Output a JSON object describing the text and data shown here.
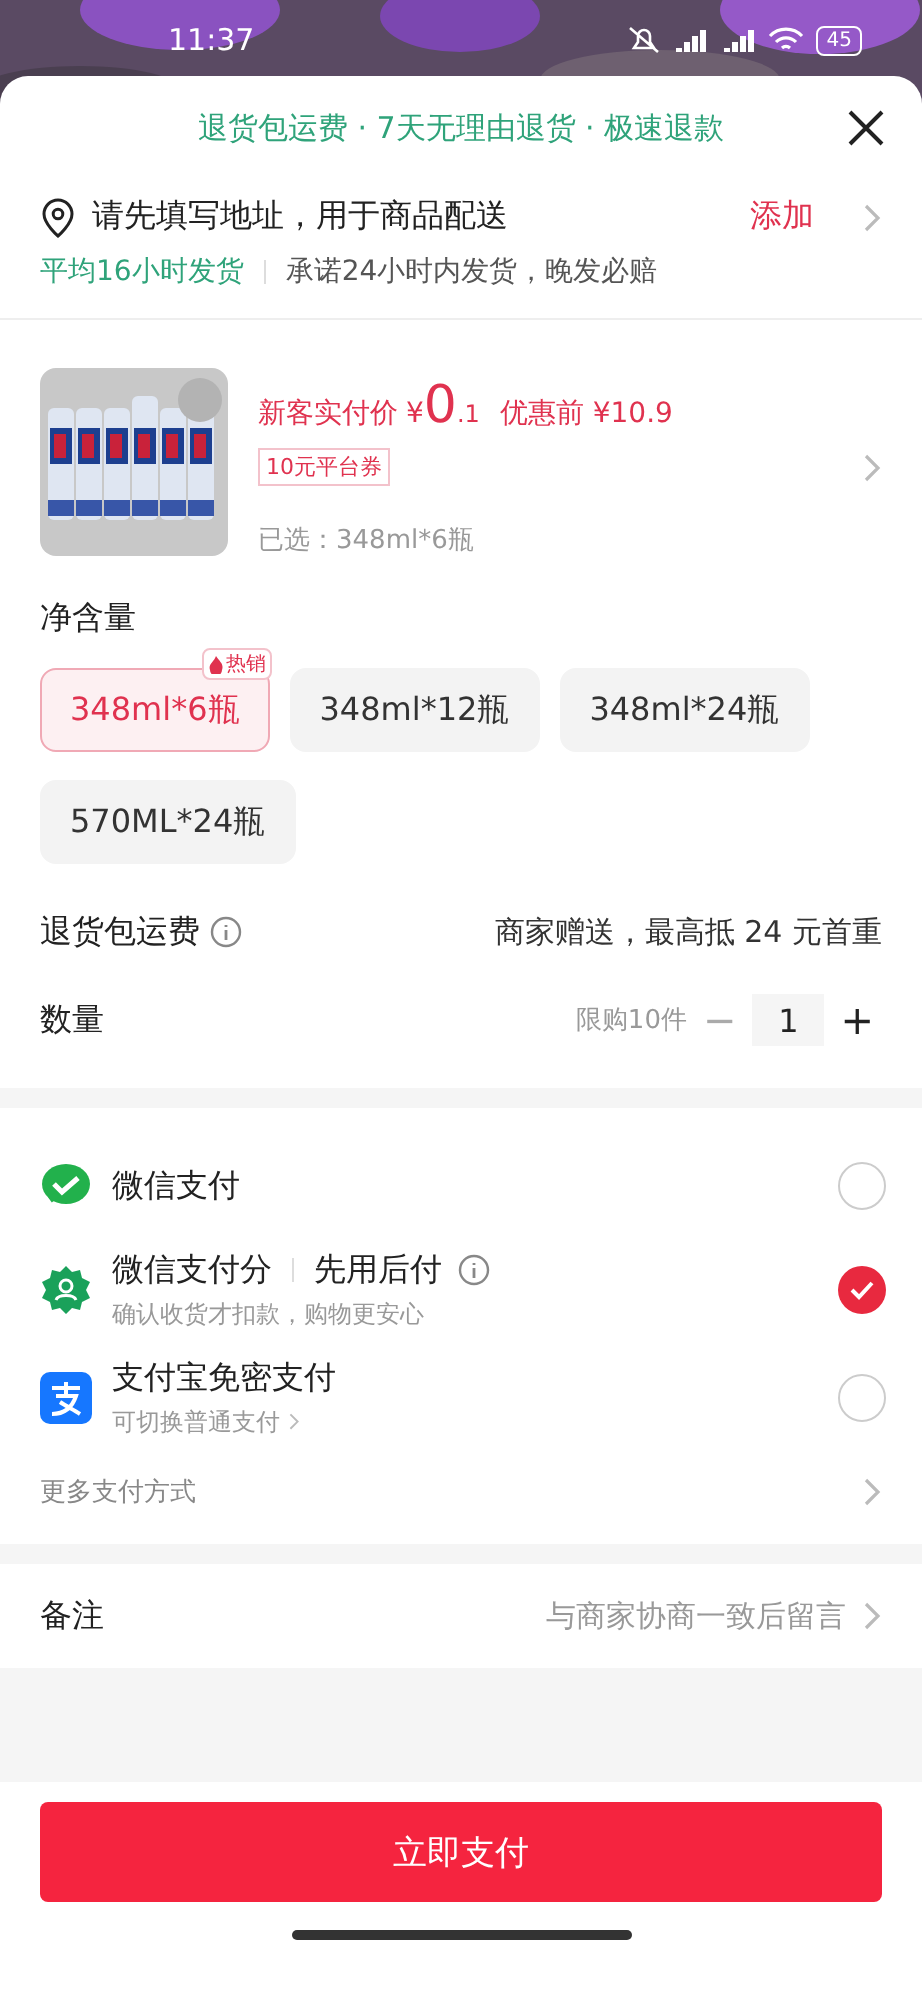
{
  "status_bar": {
    "time": "11:37",
    "battery": "45"
  },
  "header": {
    "title": "退货包运费 · 7天无理由退货 · 极速退款"
  },
  "address": {
    "prompt": "请先填写地址，用于商品配送",
    "action": "添加",
    "shipping_badge": "平均16小时发货",
    "shipping_note": "承诺24小时内发货，晚发必赔"
  },
  "product": {
    "price_label": "新客实付价",
    "currency": "¥",
    "price_int": "0",
    "price_dec": ".1",
    "original_price": "优惠前 ¥10.9",
    "coupon": "10元平台券",
    "selected_spec": "已选：348ml*6瓶"
  },
  "spec": {
    "title": "净含量",
    "options": [
      {
        "label": "348ml*6瓶",
        "selected": true,
        "tag": "热销"
      },
      {
        "label": "348ml*12瓶",
        "selected": false
      },
      {
        "label": "348ml*24瓶",
        "selected": false
      },
      {
        "label": "570ML*24瓶",
        "selected": false
      }
    ]
  },
  "return_shipping": {
    "label": "退货包运费",
    "value": "商家赠送，最高抵 24 元首重"
  },
  "quantity": {
    "label": "数量",
    "limit": "限购10件",
    "minus": "−",
    "value": "1",
    "plus": "+"
  },
  "payments": [
    {
      "kind": "wechat",
      "name": "微信支付",
      "selected": false
    },
    {
      "kind": "wechat_score",
      "name": "微信支付分",
      "tag": "先用后付",
      "sub": "确认收货才扣款，购物更安心",
      "selected": true
    },
    {
      "kind": "alipay",
      "name": "支付宝免密支付",
      "sub": "可切换普通支付",
      "selected": false
    }
  ],
  "more_payments": "更多支付方式",
  "remark": {
    "label": "备注",
    "placeholder": "与商家协商一致后留言"
  },
  "pay_button": "立即支付"
}
